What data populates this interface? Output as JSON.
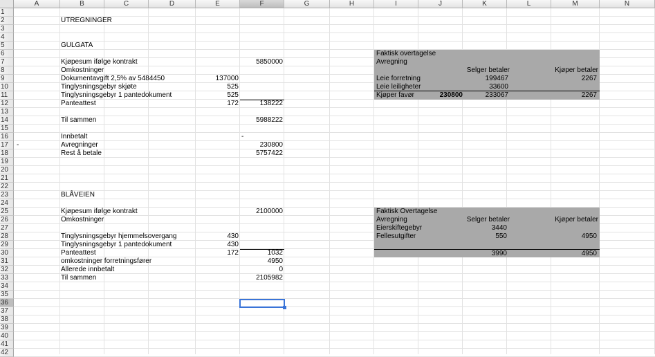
{
  "columns": [
    "A",
    "B",
    "C",
    "D",
    "E",
    "F",
    "G",
    "H",
    "I",
    "J",
    "K",
    "L",
    "M",
    "N"
  ],
  "selected_column": "F",
  "rows": [
    "1",
    "2",
    "3",
    "4",
    "5",
    "6",
    "7",
    "8",
    "9",
    "10",
    "11",
    "12",
    "13",
    "14",
    "15",
    "16",
    "17",
    "18",
    "19",
    "20",
    "21",
    "22",
    "23",
    "24",
    "25",
    "26",
    "27",
    "28",
    "29",
    "30",
    "31",
    "32",
    "33",
    "34",
    "35",
    "36",
    "37",
    "38",
    "39",
    "40",
    "41",
    "42"
  ],
  "selected_row": "36",
  "title": "UTREGNINGER",
  "gulgata": {
    "heading": "GULGATA",
    "items": [
      {
        "row": 7,
        "label": "Kjøpesum ifølge kontrakt",
        "f": "5850000"
      },
      {
        "row": 8,
        "label": "Omkostninger"
      },
      {
        "row": 9,
        "label": "Dokumentavgift 2,5% av 5484450",
        "e": "137000"
      },
      {
        "row": 10,
        "label": "Tinglysningsgebyr skjøte",
        "e": "525"
      },
      {
        "row": 11,
        "label": "Tinglysningsgebyr 1 pantedokument",
        "e": "525"
      },
      {
        "row": 12,
        "label": "Panteattest",
        "e": "172",
        "f": "138222"
      },
      {
        "row": 14,
        "label": "Til sammen",
        "f": "5988222"
      },
      {
        "row": 16,
        "label": "Innbetalt",
        "f": "-"
      },
      {
        "row": 17,
        "a": "-",
        "label": "Avregninger",
        "f": "230800"
      },
      {
        "row": 18,
        "label": "Rest å betale",
        "f": "5757422"
      }
    ],
    "box": {
      "title": "Faktisk overtagelse",
      "subtitle": "Avregning",
      "col_seller": "Selger betaler",
      "col_buyer": "Kjøper betaler",
      "lines": [
        {
          "label": "Leie forretning",
          "seller": "199467"
        },
        {
          "label": "Leie leiligheter",
          "seller": "33600"
        }
      ],
      "total": {
        "label": "Kjøper favør",
        "j": "230800",
        "seller": "233067",
        "buyer": "2267"
      },
      "buyer_row9": "2267"
    }
  },
  "blaaveien": {
    "heading": "BLÅVEIEN",
    "items": [
      {
        "row": 25,
        "label": "Kjøpesum ifølge kontrakt",
        "f": "2100000"
      },
      {
        "row": 26,
        "label": "Omkostninger"
      },
      {
        "row": 28,
        "label": "Tinglysningsgebyr hjemmelsovergang",
        "e": "430"
      },
      {
        "row": 29,
        "label": "Tinglysningsgebyr 1 pantedokument",
        "e": "430"
      },
      {
        "row": 30,
        "label": "Panteattest",
        "e": "172",
        "f": "1032"
      },
      {
        "row": 31,
        "label": "omkostninger forretningsfører",
        "f": "4950"
      },
      {
        "row": 32,
        "label": "Allerede innbetalt",
        "f": "0"
      },
      {
        "row": 33,
        "label": "Til sammen",
        "f": "2105982"
      }
    ],
    "box": {
      "title": "Faktisk Overtagelse",
      "subtitle": "Avregning",
      "col_seller": "Selger betaler",
      "col_buyer": "Kjøper betaler",
      "lines": [
        {
          "label": "Eierskiftegebyr",
          "seller": "3440"
        },
        {
          "label": "Fellesutgifter",
          "seller": "550",
          "buyer": "4950"
        }
      ],
      "total": {
        "seller": "3990",
        "buyer": "4950"
      }
    }
  }
}
